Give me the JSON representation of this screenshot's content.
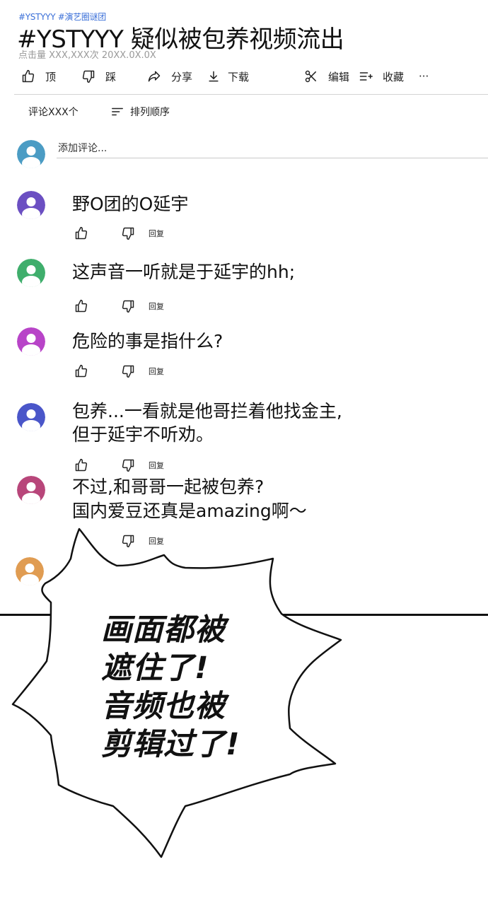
{
  "header": {
    "tags": "#YSTYYY #演艺圈谜团",
    "title": "#YSTYYY 疑似被包养视频流出",
    "meta": "点击量 XXX,XXX次  20XX.0X.0X"
  },
  "actions": {
    "like": "顶",
    "dislike": "踩",
    "share": "分享",
    "download": "下载",
    "edit": "编辑",
    "save": "收藏",
    "more": "···"
  },
  "comments_bar": {
    "count": "评论XXX个",
    "sort": "排列顺序"
  },
  "add_comment": {
    "placeholder": "添加评论..."
  },
  "comments": [
    {
      "lines": [
        "野O团的O延宇"
      ],
      "reply": "回复",
      "avatar_color": "#6b4fc2"
    },
    {
      "lines": [
        "这声音一听就是于延宇的hh;"
      ],
      "reply": "回复",
      "avatar_color": "#3fae6c"
    },
    {
      "lines": [
        "危险的事是指什么?"
      ],
      "reply": "回复",
      "avatar_color": "#b844c8"
    },
    {
      "lines": [
        "包养...一看就是他哥拦着他找金主,",
        "但于延宇不听劝。"
      ],
      "reply": "回复",
      "avatar_color": "#4a56c9"
    },
    {
      "lines": [
        "不过,和哥哥一起被包养?",
        "国内爱豆还真是amazing啊～"
      ],
      "reply": "回复",
      "avatar_color": "#b8467a"
    }
  ],
  "last_avatar_color": "#e09c52",
  "first_avatar_color": "#4b9cc4",
  "speech_bubble": {
    "lines": [
      "画面都被",
      "遮住了!",
      "音频也被",
      "剪辑过了!"
    ]
  }
}
